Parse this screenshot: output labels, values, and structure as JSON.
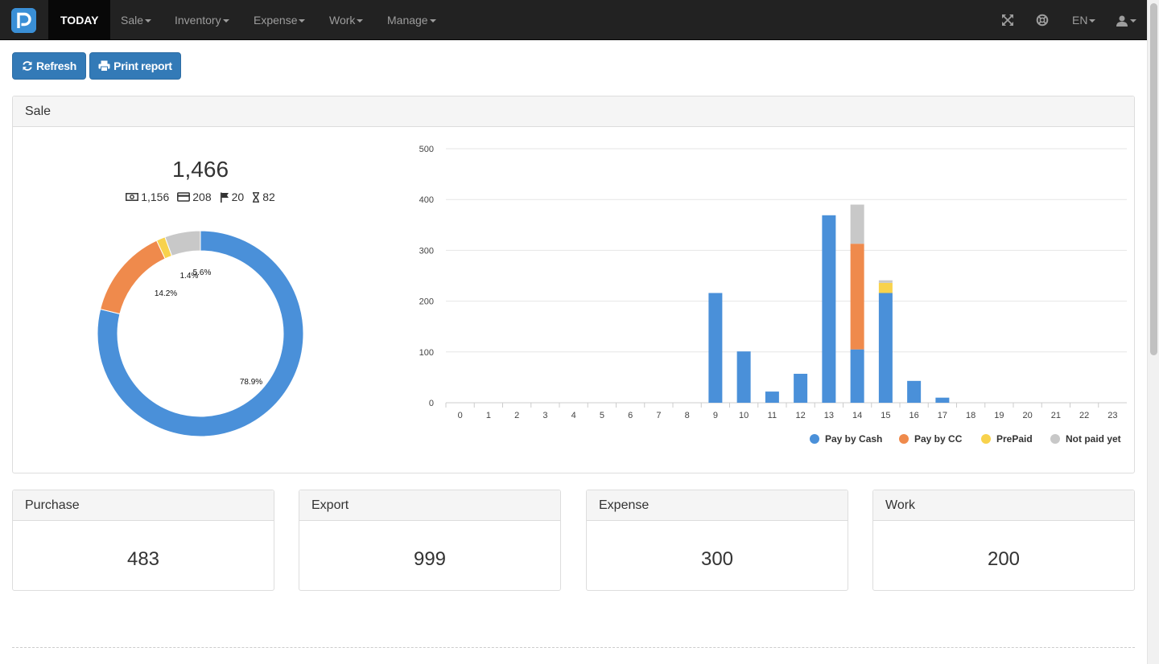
{
  "nav": {
    "brand_icon": "brand-p-logo-icon",
    "items": [
      {
        "label": "TODAY",
        "active": true,
        "caret": false
      },
      {
        "label": "Sale",
        "active": false,
        "caret": true
      },
      {
        "label": "Inventory",
        "active": false,
        "caret": true
      },
      {
        "label": "Expense",
        "active": false,
        "caret": true
      },
      {
        "label": "Work",
        "active": false,
        "caret": true
      },
      {
        "label": "Manage",
        "active": false,
        "caret": true
      }
    ],
    "right": {
      "fullscreen_icon": "fullscreen-icon",
      "help_icon": "lifebuoy-icon",
      "language": "EN",
      "user_icon": "user-icon"
    }
  },
  "toolbar": {
    "refresh_label": "Refresh",
    "print_label": "Print report"
  },
  "sale": {
    "title": "Sale",
    "total": "1,466",
    "breakdown": [
      {
        "icon": "cash-icon",
        "value": "1,156"
      },
      {
        "icon": "credit-card-icon",
        "value": "208"
      },
      {
        "icon": "flag-icon",
        "value": "20"
      },
      {
        "icon": "hourglass-icon",
        "value": "82"
      }
    ]
  },
  "cards": [
    {
      "title": "Purchase",
      "value": "483"
    },
    {
      "title": "Export",
      "value": "999"
    },
    {
      "title": "Expense",
      "value": "300"
    },
    {
      "title": "Work",
      "value": "200"
    }
  ],
  "colors": {
    "cash": "#4a90d9",
    "cc": "#ef8a4c",
    "prepaid": "#f8d24c",
    "unpaid": "#c8c8c8",
    "nav_bg": "#222222",
    "button": "#337ab7"
  },
  "chart_data": [
    {
      "type": "pie",
      "variant": "donut",
      "slices": [
        {
          "name": "Pay by Cash",
          "value": 78.9,
          "label": "78.9%"
        },
        {
          "name": "Pay by CC",
          "value": 14.2,
          "label": "14.2%"
        },
        {
          "name": "PrePaid",
          "value": 1.4,
          "label": "1.4%"
        },
        {
          "name": "Not paid yet",
          "value": 5.6,
          "label": "5.6%"
        }
      ]
    },
    {
      "type": "bar",
      "stacked": true,
      "categories": [
        "0",
        "1",
        "2",
        "3",
        "4",
        "5",
        "6",
        "7",
        "8",
        "9",
        "10",
        "11",
        "12",
        "13",
        "14",
        "15",
        "16",
        "17",
        "18",
        "19",
        "20",
        "21",
        "22",
        "23"
      ],
      "ylim": [
        0,
        500
      ],
      "yticks": [
        "0",
        "100",
        "200",
        "300",
        "400",
        "500"
      ],
      "grid": true,
      "legend_position": "bottom-right",
      "series": [
        {
          "name": "Pay by Cash",
          "values": [
            0,
            0,
            0,
            0,
            0,
            0,
            0,
            0,
            0,
            216,
            101,
            22,
            57,
            369,
            105,
            216,
            43,
            10,
            0,
            0,
            0,
            0,
            0,
            0
          ]
        },
        {
          "name": "Pay by CC",
          "values": [
            0,
            0,
            0,
            0,
            0,
            0,
            0,
            0,
            0,
            0,
            0,
            0,
            0,
            0,
            208,
            0,
            0,
            0,
            0,
            0,
            0,
            0,
            0,
            0
          ]
        },
        {
          "name": "PrePaid",
          "values": [
            0,
            0,
            0,
            0,
            0,
            0,
            0,
            0,
            0,
            0,
            0,
            0,
            0,
            0,
            0,
            20,
            0,
            0,
            0,
            0,
            0,
            0,
            0,
            0
          ]
        },
        {
          "name": "Not paid yet",
          "values": [
            0,
            0,
            0,
            0,
            0,
            0,
            0,
            0,
            0,
            0,
            0,
            0,
            0,
            0,
            77,
            5,
            0,
            0,
            0,
            0,
            0,
            0,
            0,
            0
          ]
        }
      ]
    }
  ]
}
